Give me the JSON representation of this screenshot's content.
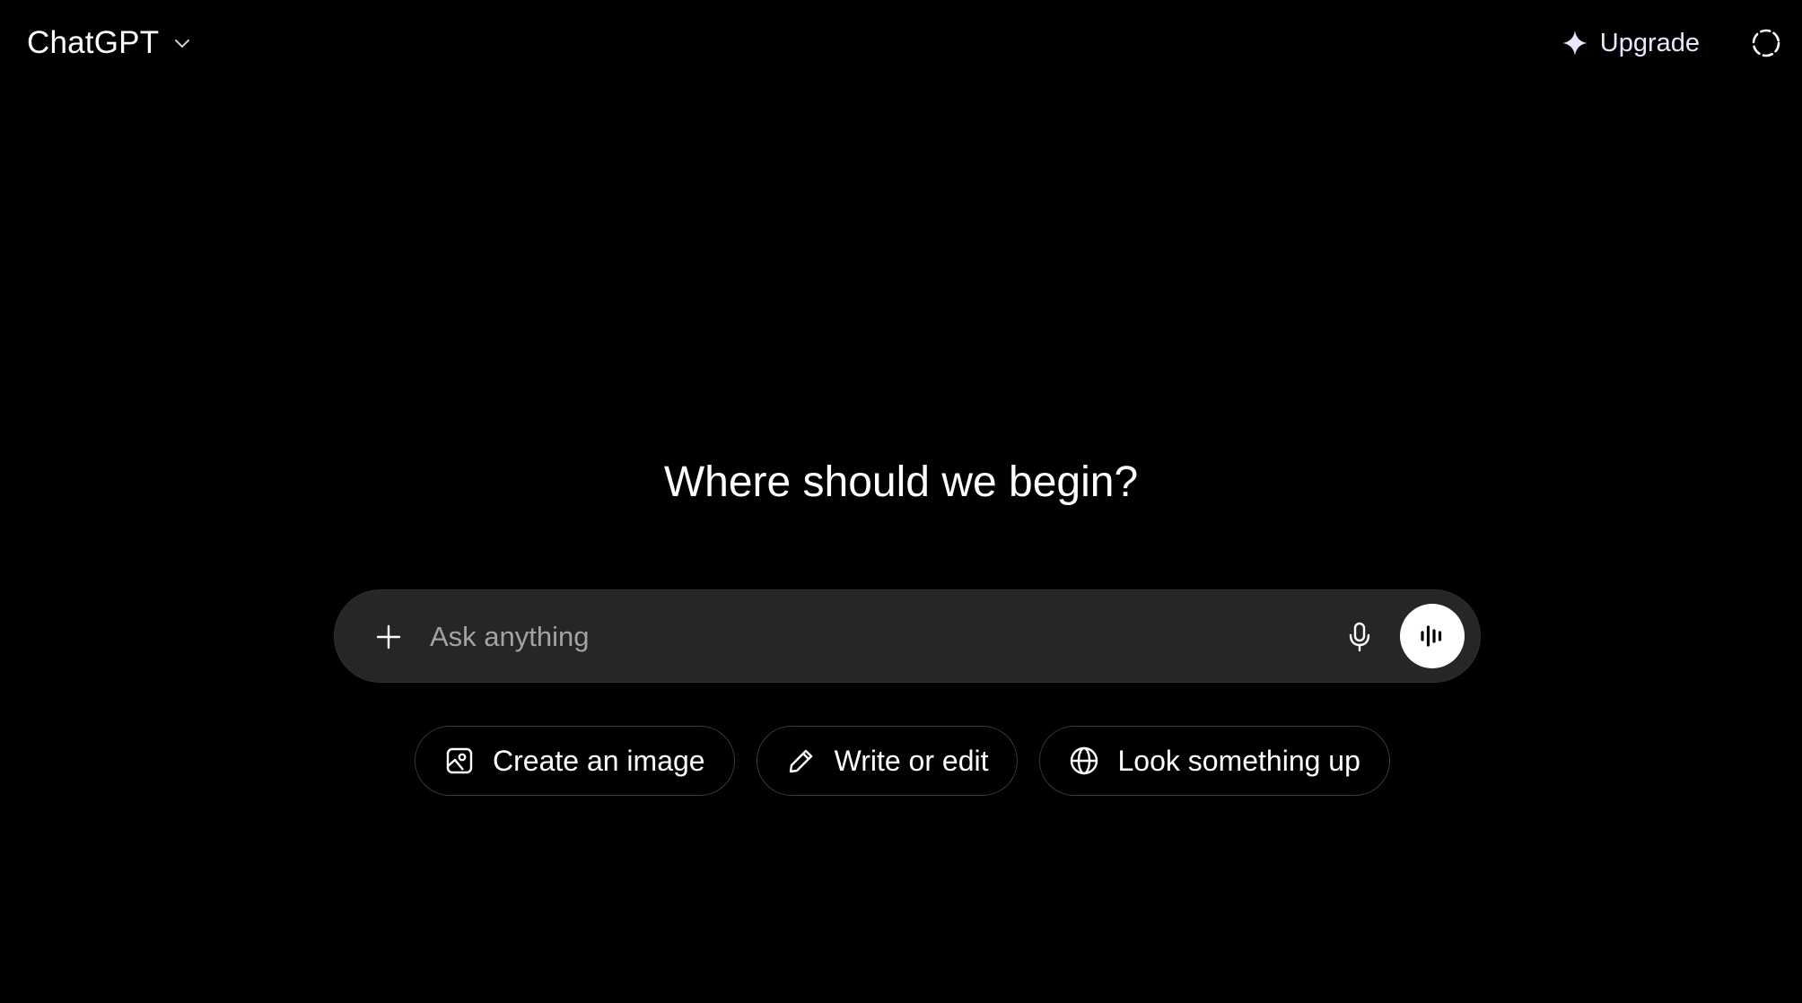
{
  "header": {
    "model_name": "ChatGPT",
    "upgrade_label": "Upgrade",
    "accent_color": "#e9e6ff"
  },
  "main": {
    "headline": "Where should we begin?",
    "composer": {
      "placeholder": "Ask anything",
      "value": ""
    },
    "chips": [
      {
        "label": "Create an image",
        "icon": "image-icon"
      },
      {
        "label": "Write or edit",
        "icon": "pencil-icon"
      },
      {
        "label": "Look something up",
        "icon": "globe-icon"
      }
    ]
  },
  "theme": {
    "background": "#000000",
    "composer_background": "#262626",
    "voice_button_background": "#ffffff"
  }
}
